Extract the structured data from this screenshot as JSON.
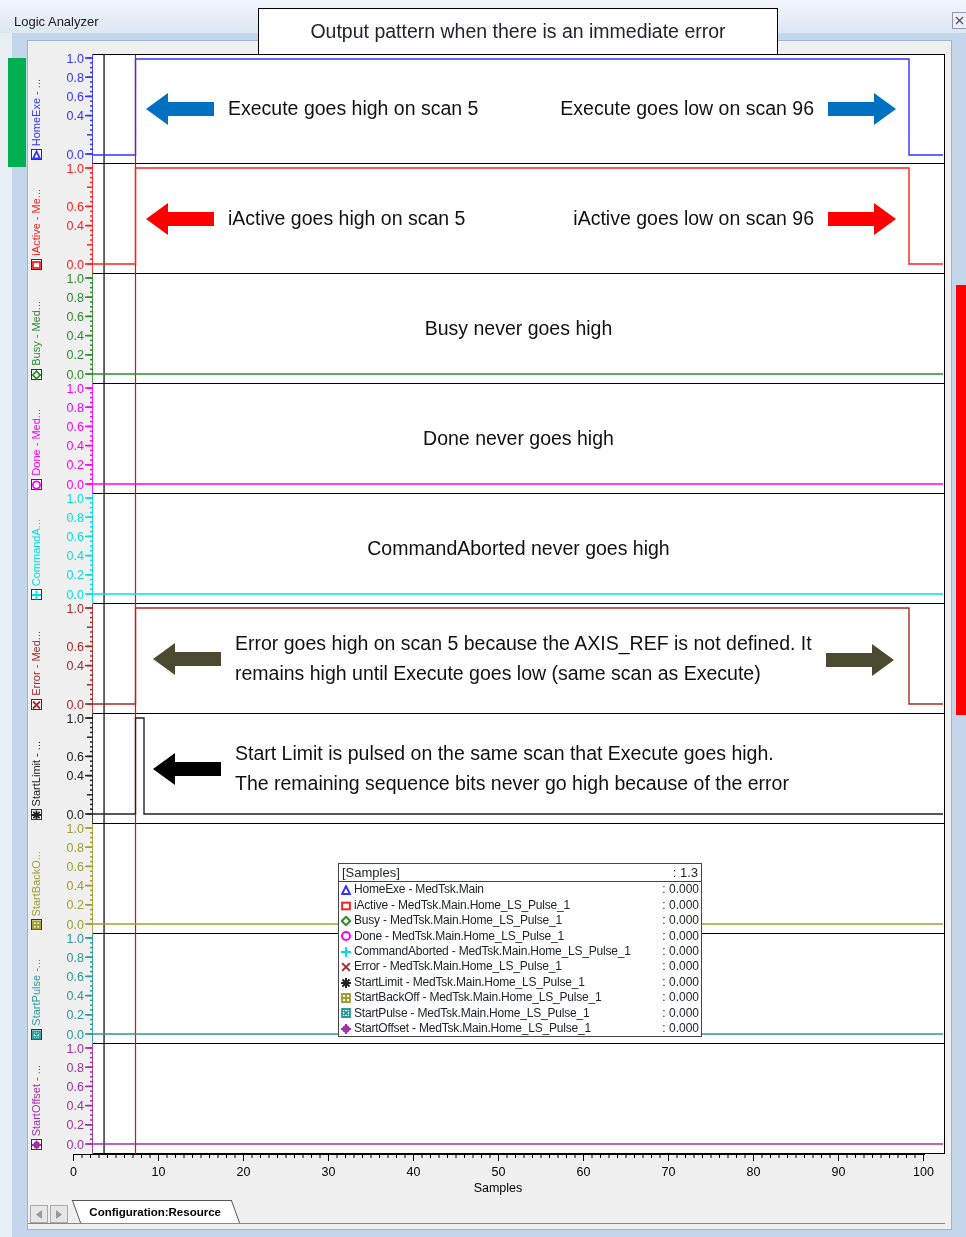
{
  "window": {
    "title": "Logic Analyzer"
  },
  "caption": "Output pattern when there is an immediate error",
  "side_marks": [
    {
      "color": "#00b050"
    },
    {
      "color": "#ff0000"
    }
  ],
  "channels": [
    {
      "label": "HomeExe - ...",
      "color": "#3333ff",
      "marker": {
        "kind": "triangle"
      },
      "trace": {
        "kind": "window"
      },
      "yticks": [
        "1.0",
        "0.8",
        "0.6",
        "0.4",
        "0.0"
      ],
      "callouts": [
        {
          "text": "Execute goes high on scan 5",
          "kind": "leftarrow",
          "color": "#0070c0"
        },
        {
          "text": "Execute goes low on scan 96",
          "kind": "rightarrow",
          "color": "#0070c0"
        }
      ]
    },
    {
      "label": "iActive - Me...",
      "color": "#ff2020",
      "marker": {
        "kind": "square"
      },
      "trace": {
        "kind": "window"
      },
      "yticks": [
        "1.0",
        "0.6",
        "0.4",
        "0.0"
      ],
      "callouts": [
        {
          "text": "iActive goes high on scan 5",
          "kind": "leftarrow",
          "color": "#ff0000"
        },
        {
          "text": "iActive goes low on scan 96",
          "kind": "rightarrow",
          "color": "#ff0000"
        }
      ]
    },
    {
      "label": "Busy - Med...",
      "color": "#2e8b2e",
      "marker": {
        "kind": "diamond"
      },
      "trace": {
        "kind": "flat"
      },
      "yticks": [
        "1.0",
        "0.8",
        "0.6",
        "0.4",
        "0.2",
        "0.0"
      ],
      "callouts": [
        {
          "text": "Busy never goes high",
          "kind": "plain"
        }
      ]
    },
    {
      "label": "Done - Med...",
      "color": "#ff00ff",
      "marker": {
        "kind": "circle"
      },
      "trace": {
        "kind": "flat"
      },
      "yticks": [
        "1.0",
        "0.8",
        "0.6",
        "0.4",
        "0.2",
        "0.0"
      ],
      "callouts": [
        {
          "text": "Done never goes high",
          "kind": "plain"
        }
      ]
    },
    {
      "label": "CommandA...",
      "color": "#00e0e0",
      "marker": {
        "kind": "plus"
      },
      "trace": {
        "kind": "flat"
      },
      "yticks": [
        "1.0",
        "0.8",
        "0.6",
        "0.4",
        "0.2",
        "0.0"
      ],
      "callouts": [
        {
          "text": "CommandAborted never goes high",
          "kind": "plain"
        }
      ]
    },
    {
      "label": "Error - Med...",
      "color": "#a52a2a",
      "marker": {
        "kind": "cross"
      },
      "trace": {
        "kind": "window"
      },
      "yticks": [
        "1.0",
        "0.6",
        "0.4",
        "0.0"
      ],
      "callouts": [
        {
          "text": "Error goes high on scan 5 because the AXIS_REF is not defined.  It\nremains high until Execute goes low (same scan as Execute)",
          "kind": "botharrows",
          "color": "#4a4a30"
        }
      ]
    },
    {
      "label": "StartLimit - ...",
      "color": "#222222",
      "marker": {
        "kind": "asterisk"
      },
      "trace": {
        "kind": "blip"
      },
      "yticks": [
        "1.0",
        "0.6",
        "0.4",
        "0.0"
      ],
      "callouts": [
        {
          "text": "Start Limit is pulsed on the same scan that Execute goes high.\nThe remaining sequence bits never go high because of the error",
          "kind": "leftarrow",
          "color": "#000000"
        }
      ]
    },
    {
      "label": "StartBackO...",
      "color": "#a0a030",
      "marker": {
        "kind": "gridsquare"
      },
      "trace": {
        "kind": "flat"
      },
      "yticks": [
        "1.0",
        "0.8",
        "0.6",
        "0.4",
        "0.2",
        "0.0"
      ]
    },
    {
      "label": "StartPulse -...",
      "color": "#2a9a9a",
      "marker": {
        "kind": "crossedsquare"
      },
      "trace": {
        "kind": "flat"
      },
      "yticks": [
        "1.0",
        "0.8",
        "0.6",
        "0.4",
        "0.2",
        "0.0"
      ]
    },
    {
      "label": "StartOffset - ...",
      "color": "#a030a0",
      "marker": {
        "kind": "crosshair"
      },
      "trace": {
        "kind": "flat"
      },
      "yticks": [
        "1.0",
        "0.8",
        "0.6",
        "0.4",
        "0.2",
        "0.0"
      ]
    }
  ],
  "legend": {
    "header": "[Samples]",
    "value": ": 1.3",
    "rows": [
      {
        "kind": "triangle",
        "color": "#3333ff",
        "label": "HomeExe - MedTsk.Main",
        "value": ": 0.000"
      },
      {
        "kind": "square",
        "color": "#ff2020",
        "label": "iActive - MedTsk.Main.Home_LS_Pulse_1",
        "value": ": 0.000"
      },
      {
        "kind": "diamond",
        "color": "#2e8b2e",
        "label": "Busy - MedTsk.Main.Home_LS_Pulse_1",
        "value": ": 0.000"
      },
      {
        "kind": "circle",
        "color": "#ff00ff",
        "label": "Done - MedTsk.Main.Home_LS_Pulse_1",
        "value": ": 0.000"
      },
      {
        "kind": "plus",
        "color": "#00e0e0",
        "label": "CommandAborted - MedTsk.Main.Home_LS_Pulse_1",
        "value": ": 0.000"
      },
      {
        "kind": "cross",
        "color": "#a52a2a",
        "label": "Error - MedTsk.Main.Home_LS_Pulse_1",
        "value": ": 0.000"
      },
      {
        "kind": "asterisk",
        "color": "#222222",
        "label": "StartLimit - MedTsk.Main.Home_LS_Pulse_1",
        "value": ": 0.000"
      },
      {
        "kind": "gridsquare",
        "color": "#a0a030",
        "label": "StartBackOff - MedTsk.Main.Home_LS_Pulse_1",
        "value": ": 0.000"
      },
      {
        "kind": "crossedsquare",
        "color": "#2a9a9a",
        "label": "StartPulse - MedTsk.Main.Home_LS_Pulse_1",
        "value": ": 0.000"
      },
      {
        "kind": "crosshair",
        "color": "#a030a0",
        "label": "StartOffset - MedTsk.Main.Home_LS_Pulse_1",
        "value": ": 0.000"
      }
    ]
  },
  "x_axis": {
    "title": "Samples",
    "ticks": [
      "0",
      "10",
      "20",
      "30",
      "40",
      "50",
      "60",
      "70",
      "80",
      "90",
      "100"
    ]
  },
  "tabs": [
    {
      "label": "Configuration:Resource",
      "selected": true
    }
  ]
}
